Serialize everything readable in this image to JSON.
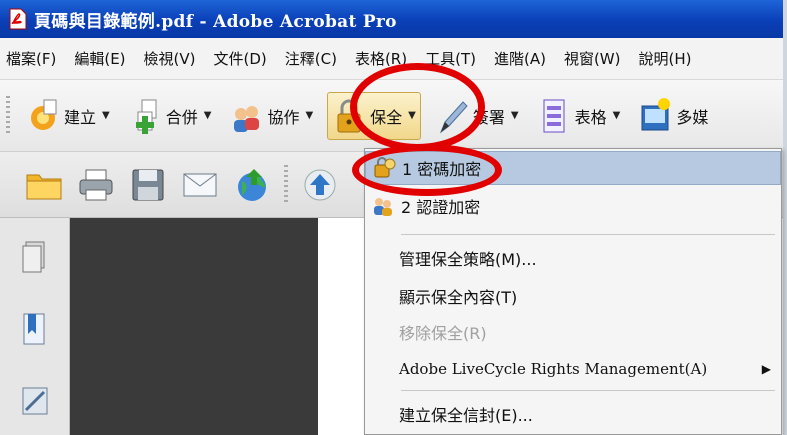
{
  "window": {
    "title": "頁碼與目錄範例.pdf - Adobe Acrobat Pro"
  },
  "menubar": [
    "檔案(F)",
    "編輯(E)",
    "檢視(V)",
    "文件(D)",
    "注釋(C)",
    "表格(R)",
    "工具(T)",
    "進階(A)",
    "視窗(W)",
    "說明(H)"
  ],
  "toolbar": {
    "create": "建立",
    "combine": "合併",
    "collaborate": "協作",
    "secure": "保全",
    "sign": "簽署",
    "forms": "表格",
    "multimedia": "多媒"
  },
  "security_menu": {
    "items": [
      "1 密碼加密",
      "2 認證加密",
      "管理保全策略(M)...",
      "顯示保全內容(T)",
      "移除保全(R)",
      "Adobe LiveCycle Rights Management(A)",
      "建立保全信封(E)..."
    ]
  },
  "colors": {
    "titlebar": "#0a3fb7",
    "highlight": "#b7c9e0",
    "annotation_ring": "#e00000"
  }
}
